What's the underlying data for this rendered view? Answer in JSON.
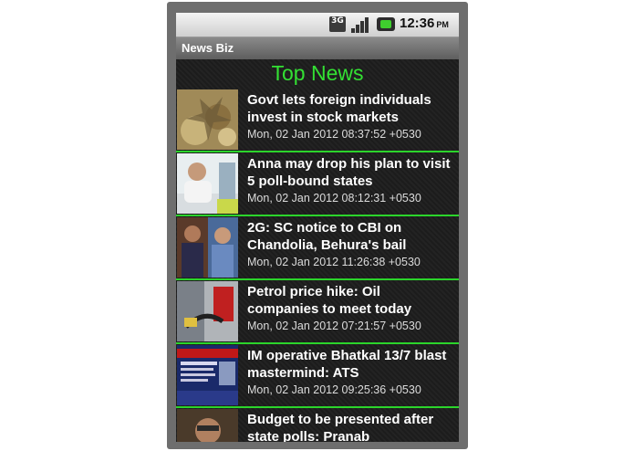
{
  "status_bar": {
    "network": "3G",
    "time": "12:36",
    "ampm": "PM",
    "icons": [
      "3g-icon",
      "signal-icon",
      "battery-icon"
    ]
  },
  "app": {
    "title": "News Biz"
  },
  "section": {
    "heading": "Top News"
  },
  "news": [
    {
      "title": "Govt lets foreign individuals invest in stock markets",
      "date": "Mon, 02 Jan 2012 08:37:52 +0530"
    },
    {
      "title": "Anna may drop his plan to visit 5 poll-bound states",
      "date": "Mon, 02 Jan 2012 08:12:31 +0530"
    },
    {
      "title": "2G: SC notice to CBI on Chandolia, Behura's bail",
      "date": "Mon, 02 Jan 2012 11:26:38 +0530"
    },
    {
      "title": "Petrol price hike: Oil companies to meet today",
      "date": "Mon, 02 Jan 2012 07:21:57 +0530"
    },
    {
      "title": "IM operative Bhatkal 13/7 blast mastermind: ATS",
      "date": "Mon, 02 Jan 2012 09:25:36 +0530"
    },
    {
      "title": "Budget to be presented after state polls: Pranab",
      "date": ""
    }
  ],
  "colors": {
    "accent": "#2bd42b",
    "heading": "#33e033",
    "background": "#1b1b1b",
    "titlebar": "#6e6e6e"
  }
}
